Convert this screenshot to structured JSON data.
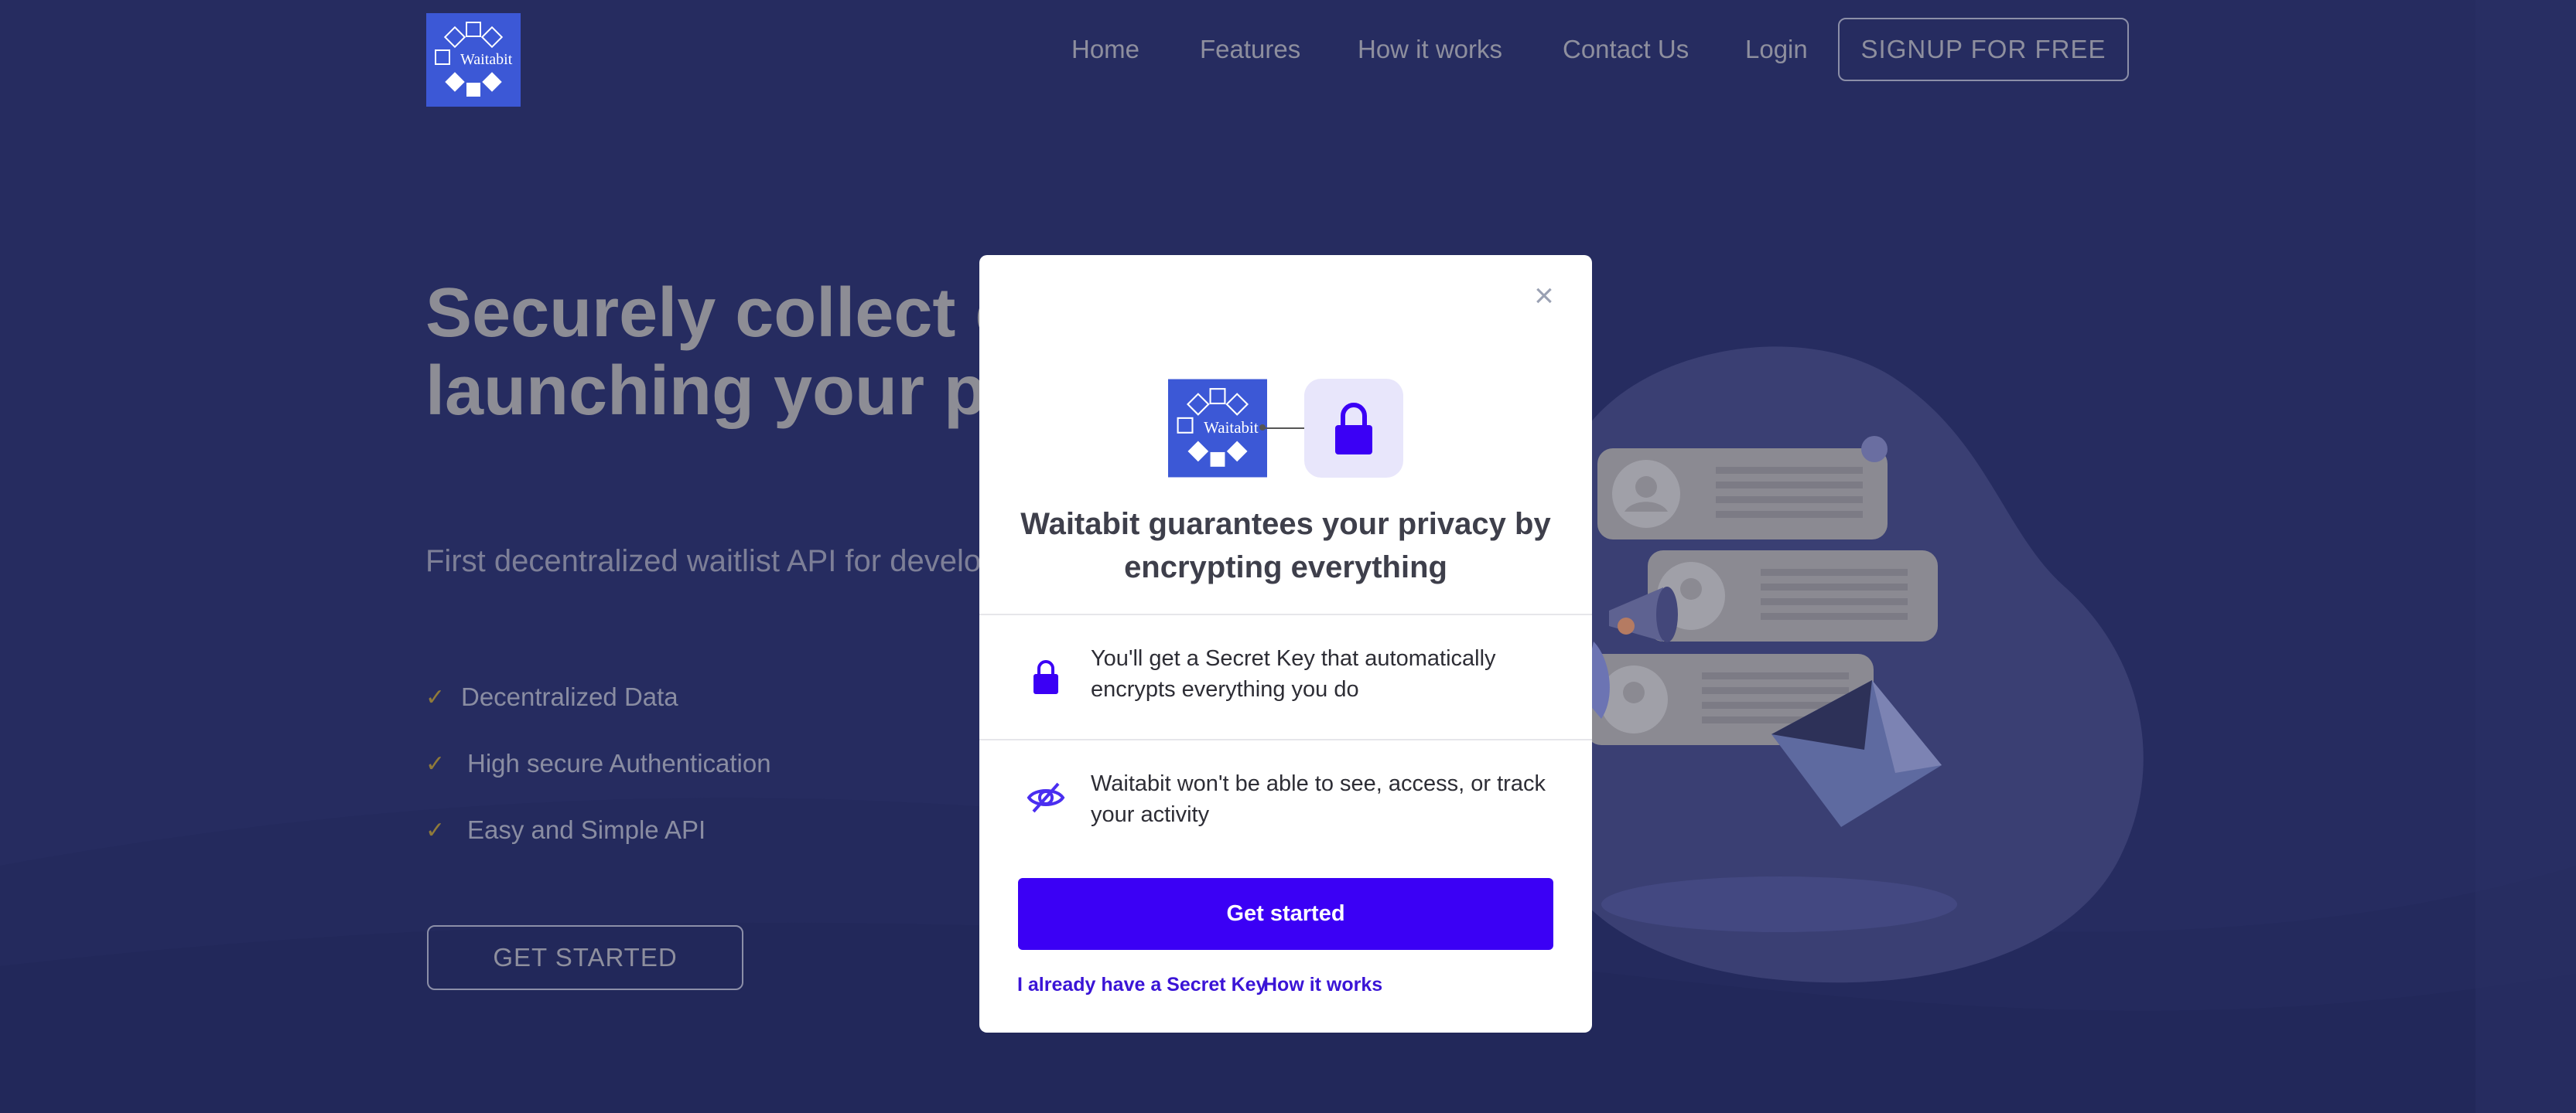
{
  "colors": {
    "background": "#262c60",
    "modal_bg": "#ffffff",
    "primary_button": "#3b00f5",
    "link": "#3a14d6",
    "lock_icon": "#3b00f5",
    "lock_box": "#e8e6fb",
    "logo_bg": "#3c58d6"
  },
  "header": {
    "logo_text": "Waitabit",
    "nav": [
      "Home",
      "Features",
      "How it works",
      "Contact Us",
      "Login"
    ],
    "signup_label": "SIGNUP FOR FREE"
  },
  "hero": {
    "title": "Securely collect emails before launching your product.",
    "subtitle": "First decentralized waitlist API for developers who care about privacy.",
    "features": [
      "Decentralized Data",
      "High secure Authentication",
      "Easy and Simple API"
    ],
    "cta_label": "GET STARTED"
  },
  "modal": {
    "close_icon": "close-icon",
    "logo_text": "Waitabit",
    "title": "Waitabit guarantees your privacy by encrypting everything",
    "items": [
      {
        "icon": "lock-icon",
        "text": "You'll get a Secret Key that automatically encrypts everything you do"
      },
      {
        "icon": "eye-slash-icon",
        "text": "Waitabit won't be able to see, access, or track your activity"
      }
    ],
    "button_label": "Get started",
    "links": [
      "I already have a Secret Key",
      "How it works"
    ]
  }
}
